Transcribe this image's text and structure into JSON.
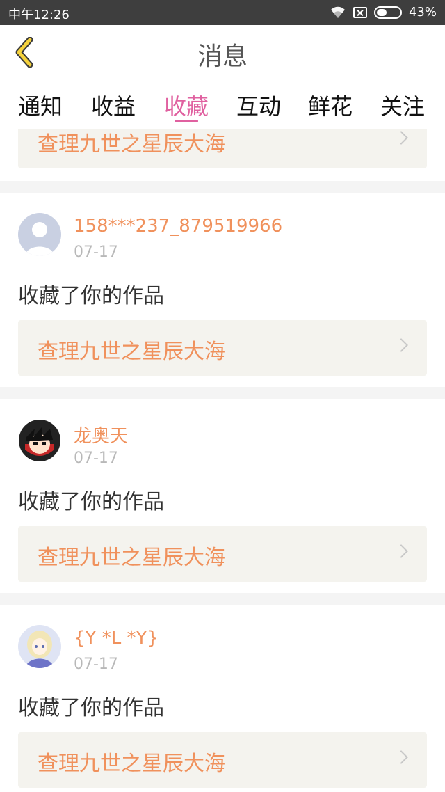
{
  "status_bar": {
    "time": "中午12:26",
    "battery": "43%",
    "battery_level": 0.43
  },
  "header": {
    "title": "消息"
  },
  "tabs": [
    {
      "label": "通知"
    },
    {
      "label": "收益"
    },
    {
      "label": "收藏",
      "active": true
    },
    {
      "label": "互动"
    },
    {
      "label": "鲜花"
    },
    {
      "label": "关注"
    }
  ],
  "colors": {
    "accent": "#e061a0",
    "link": "#f0915c",
    "card_bg": "#f4f3ee"
  },
  "feed": {
    "partial_top": {
      "work_title": "查理九世之星辰大海"
    },
    "items": [
      {
        "username": "158***237_879519966",
        "date": "07-17",
        "action": "收藏了你的作品",
        "work_title": "查理九世之星辰大海",
        "avatar": "default-avatar"
      },
      {
        "username": "龙奥天",
        "date": "07-17",
        "action": "收藏了你的作品",
        "work_title": "查理九世之星辰大海",
        "avatar": "cartoon-boy-avatar"
      },
      {
        "username": "{Y *L *Y}",
        "date": "07-17",
        "action": "收藏了你的作品",
        "work_title": "查理九世之星辰大海",
        "avatar": "anime-girl-avatar"
      }
    ]
  }
}
